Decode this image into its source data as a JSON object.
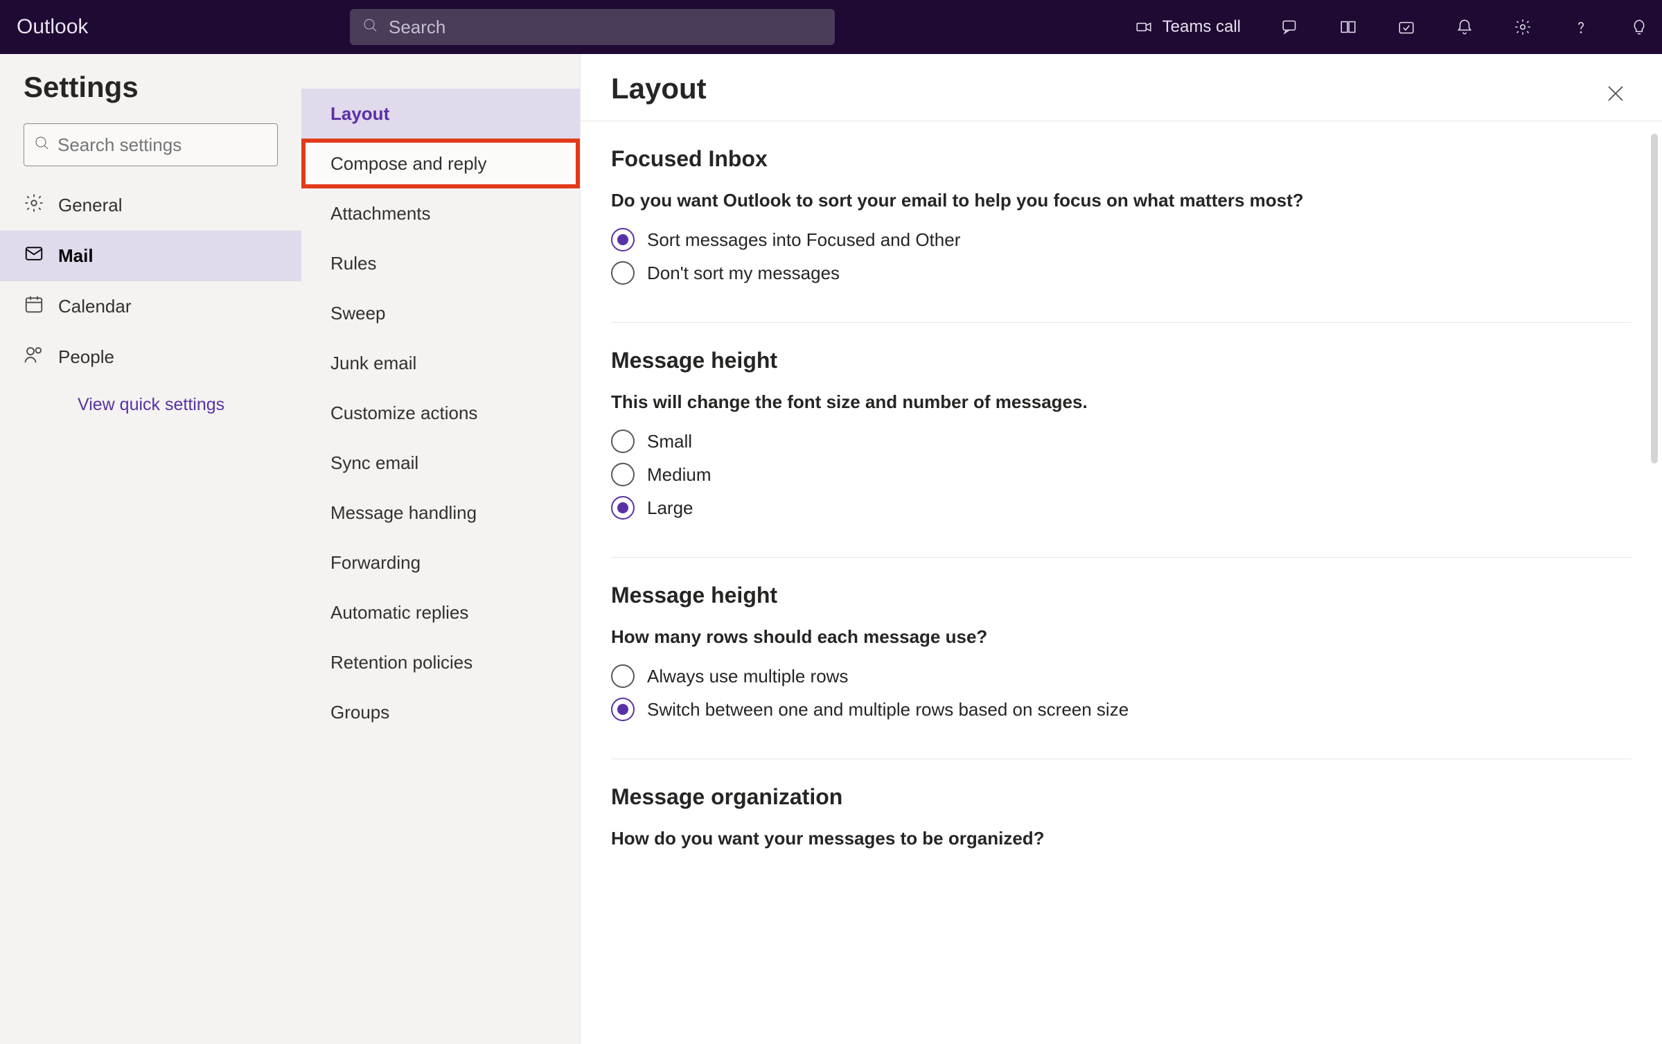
{
  "brand": "Outlook",
  "search_placeholder": "Search",
  "teams_call": "Teams call",
  "sidebar": {
    "title": "Settings",
    "search_placeholder": "Search settings",
    "items": [
      {
        "label": "General",
        "key": "general"
      },
      {
        "label": "Mail",
        "key": "mail",
        "selected": true
      },
      {
        "label": "Calendar",
        "key": "calendar"
      },
      {
        "label": "People",
        "key": "people"
      }
    ],
    "quick_link": "View quick settings"
  },
  "subnav": [
    {
      "label": "Layout",
      "selected": true
    },
    {
      "label": "Compose and reply",
      "highlighted": true
    },
    {
      "label": "Attachments"
    },
    {
      "label": "Rules"
    },
    {
      "label": "Sweep"
    },
    {
      "label": "Junk email"
    },
    {
      "label": "Customize actions"
    },
    {
      "label": "Sync email"
    },
    {
      "label": "Message handling"
    },
    {
      "label": "Forwarding"
    },
    {
      "label": "Automatic replies"
    },
    {
      "label": "Retention policies"
    },
    {
      "label": "Groups"
    }
  ],
  "page": {
    "title": "Layout",
    "sections": [
      {
        "heading": "Focused Inbox",
        "desc": "Do you want Outlook to sort your email to help you focus on what matters most?",
        "options": [
          {
            "label": "Sort messages into Focused and Other",
            "selected": true
          },
          {
            "label": "Don't sort my messages"
          }
        ]
      },
      {
        "heading": "Message height",
        "desc": "This will change the font size and number of messages.",
        "options": [
          {
            "label": "Small"
          },
          {
            "label": "Medium"
          },
          {
            "label": "Large",
            "selected": true
          }
        ]
      },
      {
        "heading": "Message height",
        "desc": "How many rows should each message use?",
        "options": [
          {
            "label": "Always use multiple rows"
          },
          {
            "label": "Switch between one and multiple rows based on screen size",
            "selected": true
          }
        ]
      },
      {
        "heading": "Message organization",
        "desc": "How do you want your messages to be organized?",
        "options": []
      }
    ]
  }
}
